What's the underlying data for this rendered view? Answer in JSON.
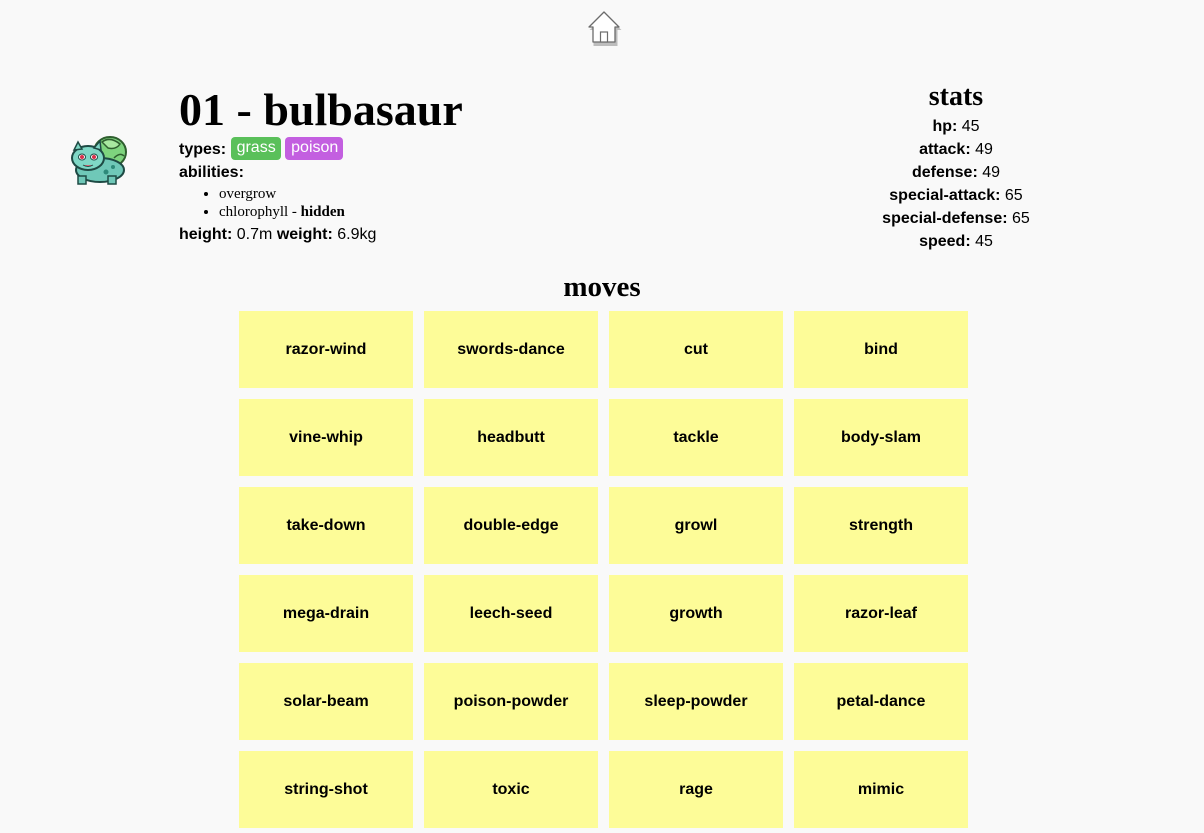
{
  "nav": {
    "home_icon": "home-icon"
  },
  "pokemon": {
    "sprite_icon": "bulbasaur-sprite",
    "title": "01 - bulbasaur",
    "types_label": "types:",
    "types": [
      {
        "name": "grass",
        "color": "#5ac05a"
      },
      {
        "name": "poison",
        "color": "#c35fe0"
      }
    ],
    "abilities_label": "abilities:",
    "abilities": [
      {
        "name": "overgrow",
        "suffix": "",
        "hidden_text": ""
      },
      {
        "name": "chlorophyll",
        "suffix": " - ",
        "hidden_text": "hidden"
      }
    ],
    "height_label": "height:",
    "height_value": "0.7m",
    "weight_label": "weight:",
    "weight_value": "6.9kg"
  },
  "stats": {
    "title": "stats",
    "items": [
      {
        "label": "hp:",
        "value": "45"
      },
      {
        "label": "attack:",
        "value": "49"
      },
      {
        "label": "defense:",
        "value": "49"
      },
      {
        "label": "special-attack:",
        "value": "65"
      },
      {
        "label": "special-defense:",
        "value": "65"
      },
      {
        "label": "speed:",
        "value": "45"
      }
    ]
  },
  "moves": {
    "title": "moves",
    "color": "#fdfc98",
    "items": [
      "razor-wind",
      "swords-dance",
      "cut",
      "bind",
      "vine-whip",
      "headbutt",
      "tackle",
      "body-slam",
      "take-down",
      "double-edge",
      "growl",
      "strength",
      "mega-drain",
      "leech-seed",
      "growth",
      "razor-leaf",
      "solar-beam",
      "poison-powder",
      "sleep-powder",
      "petal-dance",
      "string-shot",
      "toxic",
      "rage",
      "mimic"
    ]
  }
}
